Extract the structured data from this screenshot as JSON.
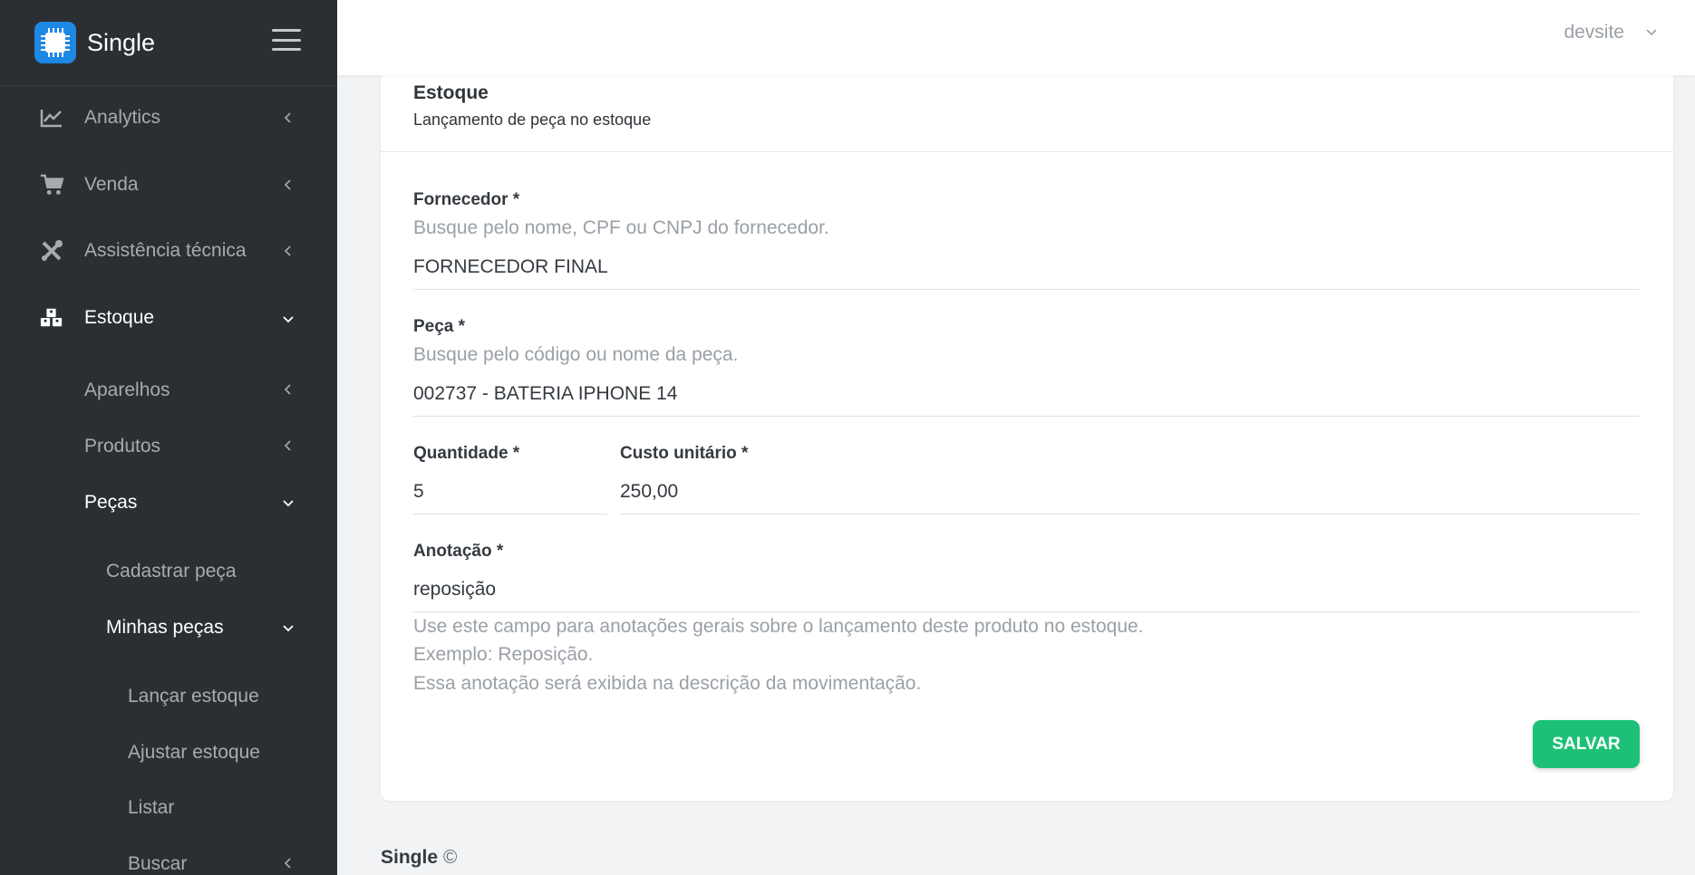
{
  "brand": {
    "name": "Single"
  },
  "sidebar": {
    "items": [
      {
        "label": "Analytics",
        "icon": "chart-line-icon"
      },
      {
        "label": "Venda",
        "icon": "cart-icon"
      },
      {
        "label": "Assistência técnica",
        "icon": "tools-icon"
      },
      {
        "label": "Estoque",
        "icon": "boxes-icon",
        "active": true
      },
      {
        "label": "Aparelhos"
      },
      {
        "label": "Produtos"
      },
      {
        "label": "Peças",
        "active": true
      },
      {
        "label": "Cadastrar peça"
      },
      {
        "label": "Minhas peças",
        "active": true
      },
      {
        "label": "Lançar estoque"
      },
      {
        "label": "Ajustar estoque"
      },
      {
        "label": "Listar"
      },
      {
        "label": "Buscar"
      }
    ]
  },
  "topbar": {
    "user": "devsite"
  },
  "card": {
    "title": "Estoque",
    "subtitle": "Lançamento de peça no estoque"
  },
  "form": {
    "supplier": {
      "label": "Fornecedor *",
      "hint": "Busque pelo nome, CPF ou CNPJ do fornecedor.",
      "value": "FORNECEDOR FINAL"
    },
    "part": {
      "label": "Peça *",
      "hint": "Busque pelo código ou nome da peça.",
      "value": "002737 - BATERIA IPHONE 14"
    },
    "quantity": {
      "label": "Quantidade *",
      "value": "5"
    },
    "unit_cost": {
      "label": "Custo unitário *",
      "value": "250,00"
    },
    "note": {
      "label": "Anotação *",
      "value": "reposição",
      "help": [
        "Use este campo para anotações gerais sobre o lançamento deste produto no estoque.",
        "Exemplo: Reposição.",
        "Essa anotação será exibida na descrição da movimentação."
      ]
    },
    "save_label": "SALVAR"
  },
  "footer": {
    "brand": "Single",
    "copyright": "©"
  },
  "colors": {
    "sidebar_bg": "#2b2f33",
    "accent": "#1e88e5",
    "save_button": "#1cc177"
  }
}
